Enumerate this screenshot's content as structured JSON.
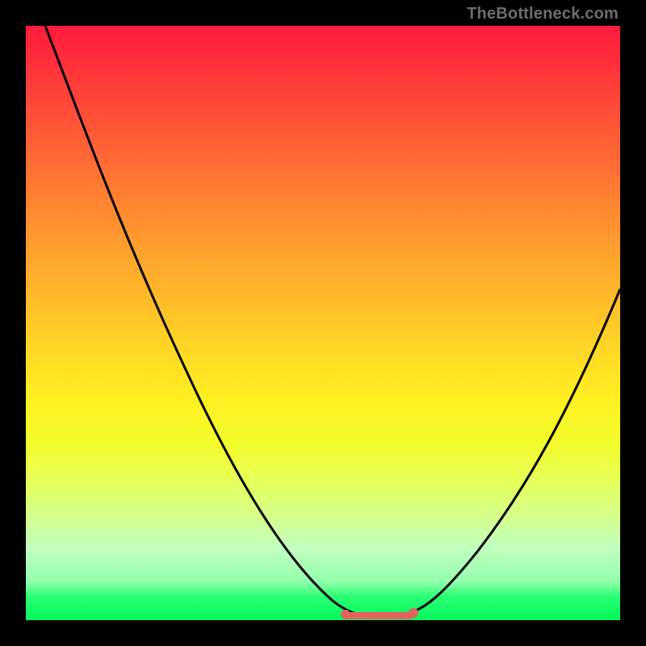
{
  "attribution": "TheBottleneck.com",
  "colors": {
    "frame_background": "#000000",
    "curve_stroke": "#000000",
    "marker": "#e4635e",
    "gradient_top": "#ff1a3e",
    "gradient_bottom": "#02f85c"
  },
  "chart_data": {
    "type": "line",
    "title": "",
    "xlabel": "",
    "ylabel": "",
    "xlim": [
      0,
      100
    ],
    "ylim": [
      0,
      100
    ],
    "grid": false,
    "series": [
      {
        "name": "bottleneck-curve",
        "x": [
          0,
          5,
          10,
          15,
          20,
          25,
          30,
          35,
          40,
          45,
          50,
          53,
          56,
          60,
          63,
          65,
          70,
          75,
          80,
          85,
          90,
          95,
          100
        ],
        "y": [
          100,
          93,
          84,
          74,
          64,
          54,
          44,
          34,
          24,
          15,
          7,
          3,
          1,
          0,
          0,
          1,
          4,
          10,
          17,
          26,
          35,
          45,
          56
        ]
      }
    ],
    "annotations": [
      {
        "name": "minimum-flat-region",
        "x_range": [
          53,
          66
        ],
        "y": 0.5,
        "color": "#e4635e"
      }
    ]
  }
}
